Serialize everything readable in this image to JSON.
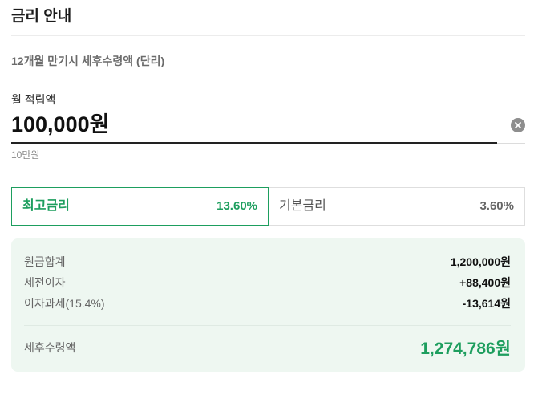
{
  "header": {
    "title": "금리 안내"
  },
  "calculator": {
    "subtitle": "12개월 만기시 세후수령액 (단리)",
    "amount_label": "월 적립액",
    "amount_value": "100,000원",
    "amount_hint": "10만원"
  },
  "rate_tabs": [
    {
      "label": "최고금리",
      "rate": "13.60%",
      "selected": true
    },
    {
      "label": "기본금리",
      "rate": "3.60%",
      "selected": false
    }
  ],
  "summary": {
    "rows": [
      {
        "label": "원금합계",
        "value": "1,200,000원"
      },
      {
        "label": "세전이자",
        "value": "+88,400원"
      },
      {
        "label": "이자과세(15.4%)",
        "value": "-13,614원"
      }
    ],
    "total_label": "세후수령액",
    "total_value": "1,274,786원"
  },
  "colors": {
    "accent": "#1d9e5e",
    "summary_background": "#eef7f1"
  },
  "icons": {
    "clear": "close-circle-icon"
  }
}
